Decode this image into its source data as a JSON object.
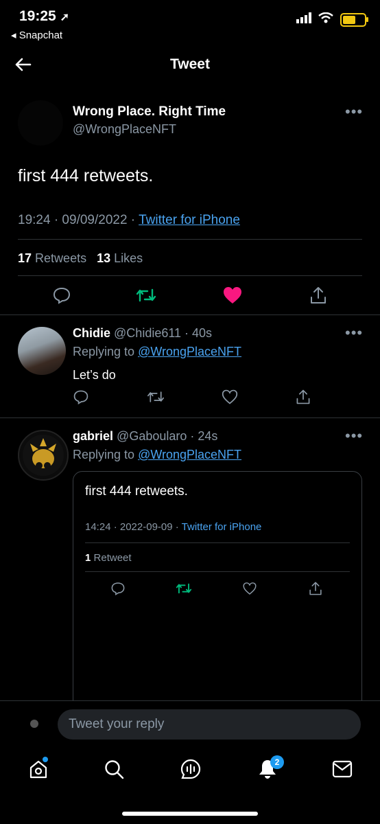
{
  "status_bar": {
    "time": "19:25",
    "back_app": "◂ Snapchat"
  },
  "header": {
    "title": "Tweet"
  },
  "main_tweet": {
    "name": "Wrong Place. Right Time",
    "handle": "@WrongPlaceNFT",
    "text": "first 444 retweets.",
    "time_date": "19:24 · 09/09/2022 · ",
    "client": "Twitter for iPhone",
    "retweets_count": "17",
    "retweets_label": "Retweets",
    "likes_count": "13",
    "likes_label": "Likes"
  },
  "replies": [
    {
      "name": "Chidie",
      "handle_time": "@Chidie611 · 40s",
      "replying_prefix": "Replying to ",
      "replying_to": "@WrongPlaceNFT",
      "text": "Let’s do"
    },
    {
      "name": "gabriel",
      "handle_time": "@Gaboularo · 24s",
      "replying_prefix": "Replying to ",
      "replying_to": "@WrongPlaceNFT",
      "embedded": {
        "text": "first 444 retweets.",
        "time_date": "14:24 · 2022-09-09 · ",
        "client": "Twitter for iPhone",
        "retweet_count": "1",
        "retweet_label": "Retweet"
      }
    }
  ],
  "reply_bar": {
    "placeholder": "Tweet your reply"
  },
  "tabbar": {
    "notifications_badge": "2"
  },
  "colors": {
    "retweet_green": "#00ba7c",
    "like_pink": "#f91880",
    "link_blue": "#4aa3f0",
    "battery_yellow": "#f2c811"
  },
  "battery": {
    "charging": true,
    "level_fraction": 0.7
  }
}
